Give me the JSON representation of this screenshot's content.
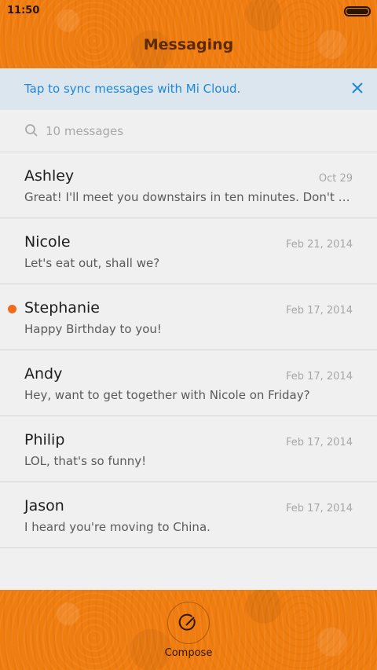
{
  "status_bar": {
    "time": "11:50"
  },
  "header": {
    "title": "Messaging"
  },
  "sync_banner": {
    "text": "Tap to sync messages with Mi Cloud."
  },
  "search": {
    "placeholder": "10 messages"
  },
  "conversations": [
    {
      "name": "Ashley",
      "date": "Oct 29",
      "snippet": "Great! I'll meet you downstairs in ten minutes. Don't forge…",
      "unread": false
    },
    {
      "name": "Nicole",
      "date": "Feb 21, 2014",
      "snippet": "Let's eat out, shall we?",
      "unread": false
    },
    {
      "name": "Stephanie",
      "date": "Feb 17, 2014",
      "snippet": "Happy Birthday to you!",
      "unread": true
    },
    {
      "name": "Andy",
      "date": "Feb 17, 2014",
      "snippet": "Hey, want to get together with Nicole on Friday?",
      "unread": false
    },
    {
      "name": "Philip",
      "date": "Feb 17, 2014",
      "snippet": "LOL, that's so funny!",
      "unread": false
    },
    {
      "name": "Jason",
      "date": "Feb 17, 2014",
      "snippet": "I heard you're moving to China.",
      "unread": false
    }
  ],
  "footer": {
    "compose_label": "Compose"
  },
  "colors": {
    "accent": "#f07d10",
    "link": "#1e87d6",
    "unread_dot": "#f26b1b"
  }
}
